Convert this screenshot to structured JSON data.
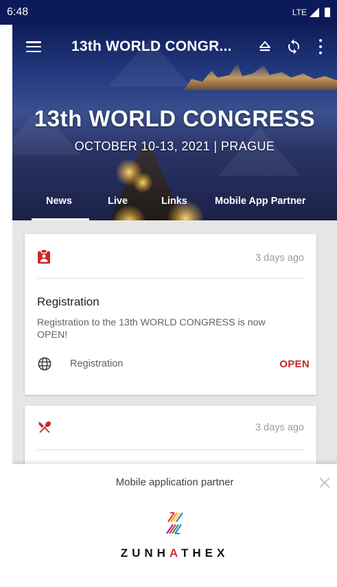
{
  "status_bar": {
    "time": "6:48",
    "network": "LTE"
  },
  "app_bar": {
    "title": "13th WORLD CONGR..."
  },
  "hero": {
    "title": "13th WORLD CONGRESS",
    "subtitle": "OCTOBER 10-13, 2021 | PRAGUE"
  },
  "tabs": [
    {
      "label": "News",
      "active": true
    },
    {
      "label": "Live"
    },
    {
      "label": "Links"
    },
    {
      "label": "Mobile App Partner"
    }
  ],
  "cards": [
    {
      "icon": "clipboard-person-icon",
      "time": "3 days ago",
      "title": "Registration",
      "text": "Registration to the 13th WORLD CONGRESS is now OPEN!",
      "link_icon": "globe-icon",
      "link_label": "Registration",
      "action": "OPEN"
    },
    {
      "icon": "fork-knife-icon",
      "time": "3 days ago"
    }
  ],
  "partner_banner": {
    "title": "Mobile application partner",
    "logo_text_parts": [
      "ZUNH",
      "A",
      "THEX"
    ]
  },
  "colors": {
    "accent": "#c62828",
    "status_bar": "#0d1a5a"
  }
}
